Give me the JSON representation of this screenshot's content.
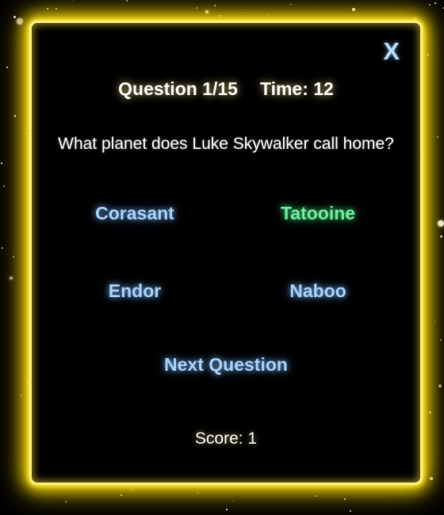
{
  "quiz": {
    "close_label": "X",
    "question_counter": "Question 1/15",
    "timer": "Time: 12",
    "question": "What planet does Luke Skywalker call home?",
    "answers": [
      {
        "label": "Corasant",
        "state": "default"
      },
      {
        "label": "Tatooine",
        "state": "correct"
      },
      {
        "label": "Endor",
        "state": "default"
      },
      {
        "label": "Naboo",
        "state": "default"
      }
    ],
    "next_label": "Next Question",
    "score": "Score: 1"
  },
  "colors": {
    "frame_glow": "#f5d800",
    "answer_default": "#a8d4ff",
    "answer_correct": "#6ff0a0",
    "background": "#000000"
  },
  "background": {
    "style": "starfield"
  }
}
